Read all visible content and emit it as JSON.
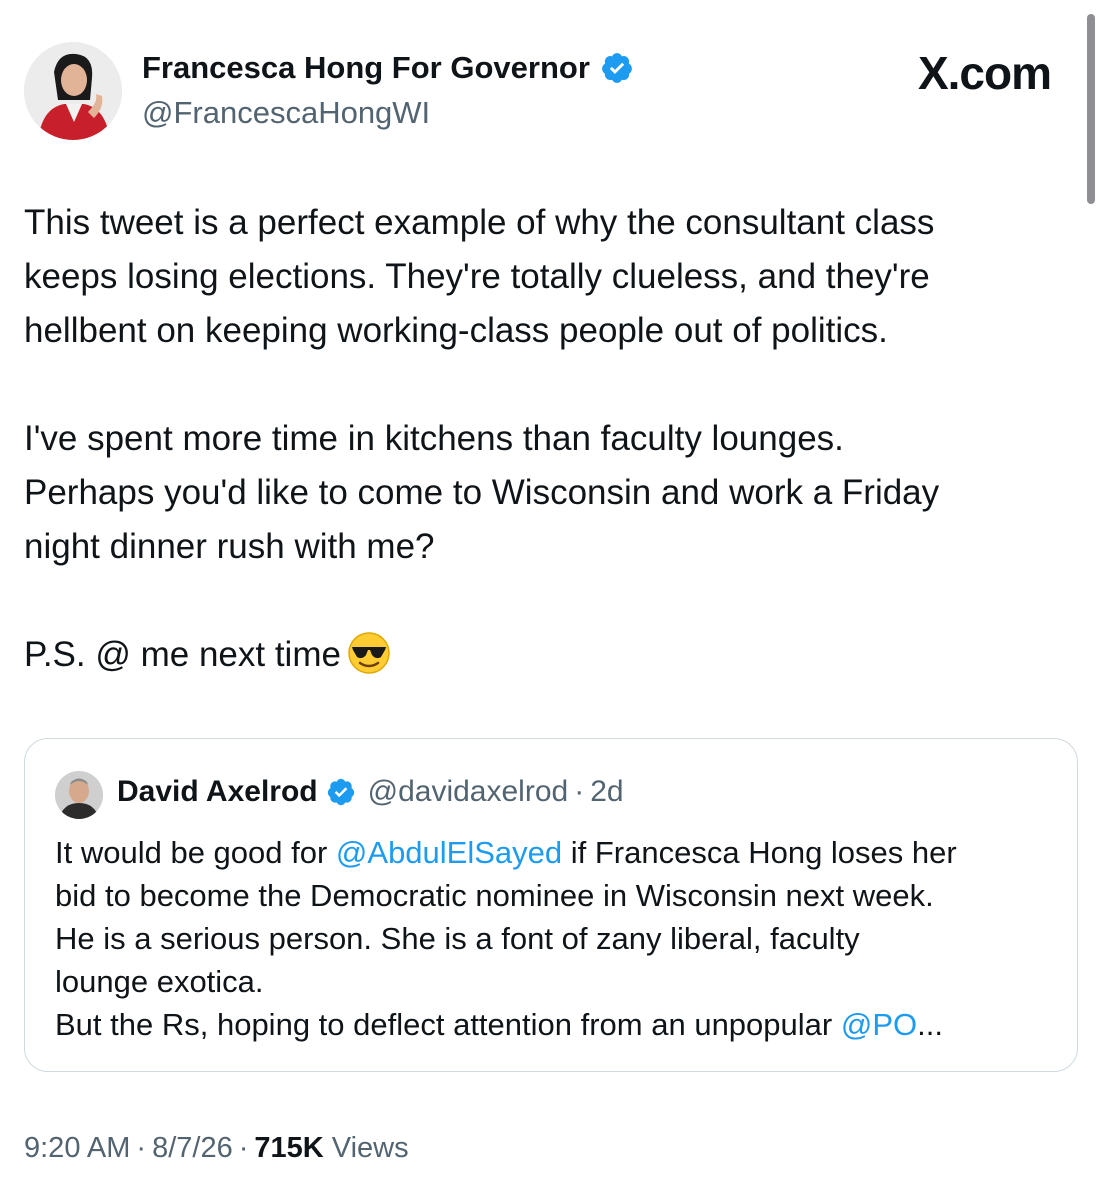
{
  "author": {
    "display_name": "Francesca Hong For Governor",
    "handle": "@FrancescaHongWI",
    "verified": true,
    "verified_color": "#1d9bf0"
  },
  "brand": "X.com",
  "tweet": {
    "paragraphs": [
      [
        "This tweet is a perfect example of why the consultant class",
        "keeps losing elections. They're totally clueless, and they're",
        "hellbent on keeping working-class people out of politics."
      ],
      [
        "I've spent more time in kitchens than faculty lounges.",
        "Perhaps you'd like to come to Wisconsin and work a Friday",
        "night dinner rush with me?"
      ],
      [
        "P.S. @ me next time"
      ]
    ],
    "emoji": "smiling-face-with-sunglasses"
  },
  "quoted_tweet": {
    "display_name": "David Axelrod",
    "handle": "@davidaxelrod",
    "separator": "·",
    "time": "2d",
    "verified": true,
    "lines": [
      [
        {
          "text": "It would be good for "
        },
        {
          "text": "@AbdulElSayed",
          "mention": true
        },
        {
          "text": " if Francesca Hong loses her"
        }
      ],
      [
        {
          "text": "bid to become the Democratic nominee in Wisconsin next week."
        }
      ],
      [
        {
          "text": "He is a serious person.  She is a font of zany liberal, faculty"
        }
      ],
      [
        {
          "text": "lounge exotica."
        }
      ],
      [
        {
          "text": "But the Rs, hoping to deflect attention from an unpopular "
        },
        {
          "text": "@PO",
          "mention": true
        },
        {
          "text": "..."
        }
      ]
    ]
  },
  "meta": {
    "time": "9:20 AM",
    "separator": "·",
    "date": "8/7/26",
    "views_count": "715K",
    "views_label": "Views"
  },
  "colors": {
    "text": "#0f1419",
    "secondary": "#536471",
    "mention": "#1d9bf0",
    "border": "#cfd9de"
  }
}
